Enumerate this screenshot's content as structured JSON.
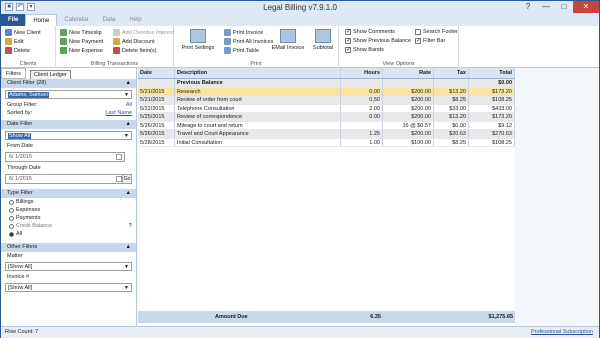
{
  "window": {
    "title": "Legal Billing v7.9.1.0"
  },
  "ribbon_tabs": [
    "File",
    "Home",
    "Calendar",
    "Data",
    "Help"
  ],
  "ribbon": {
    "clients": {
      "label": "Clients",
      "items": [
        "New Client",
        "Edit",
        "Delete"
      ]
    },
    "billing": {
      "label": "Billing Transactions",
      "items": [
        "New Timeslip",
        "New Payment",
        "New Expense",
        "Add Overdue Interest",
        "Add Discount",
        "Delete Item(s)"
      ]
    },
    "print": {
      "label": "Print",
      "print_settings": "Print Settings",
      "items": [
        "Print Invoice",
        "Print All Invoices",
        "Print Table"
      ],
      "email_invoice": "EMail Invoice",
      "subtotal": "Subtotal"
    },
    "view": {
      "label": "View Options",
      "checks": [
        {
          "label": "Show Comments",
          "checked": true
        },
        {
          "label": "Show Previous Balance",
          "checked": true
        },
        {
          "label": "Show Bands",
          "checked": true
        },
        {
          "label": "Search Footer",
          "checked": false
        },
        {
          "label": "Filter Bar",
          "checked": true
        }
      ]
    }
  },
  "left": {
    "tabs": [
      "Filters"
    ],
    "tooltip": "Client Ledger",
    "client_filter": {
      "header": "Client Filter (28)",
      "selected": "Adams, Samuel",
      "group_filter_label": "Group Filter:",
      "group_filter_value": "All",
      "sorted_by_label": "Sorted by:",
      "sorted_by_value": "Last Name"
    },
    "date_filter": {
      "header": "Date Filter",
      "selected": "Show All",
      "from_label": "From Date",
      "from_value": "6/  1/2015",
      "through_label": "Through Date",
      "through_value": "6/  1/2015",
      "go": "Go"
    },
    "type_filter": {
      "header": "Type Filter",
      "options": [
        {
          "label": "Billings",
          "on": false
        },
        {
          "label": "Expenses",
          "on": false
        },
        {
          "label": "Payments",
          "on": false
        },
        {
          "label": "Credit Balance",
          "on": false
        },
        {
          "label": "All",
          "on": true
        }
      ]
    },
    "other_filters": {
      "header": "Other Filters",
      "matter_label": "Matter",
      "matter_value": "[Show All]",
      "invoice_label": "Invoice #",
      "invoice_value": "[Show All]"
    }
  },
  "grid": {
    "columns": [
      "Date",
      "Description",
      "Hours",
      "Rate",
      "Tax",
      "Total"
    ],
    "rows": [
      {
        "date": "",
        "desc": "Previous Balance",
        "hours": "",
        "rate": "",
        "tax": "",
        "total": "$0.00",
        "style": "alt"
      },
      {
        "date": "5/21/2015",
        "desc": "Research",
        "hours": "0.00",
        "rate": "$200.00",
        "tax": "$13.20",
        "total": "$173.20",
        "style": "sel"
      },
      {
        "date": "5/21/2015",
        "desc": "Review of order from court",
        "hours": "0.50",
        "rate": "$200.00",
        "tax": "$8.25",
        "total": "$108.25",
        "style": "alt"
      },
      {
        "date": "5/22/2015",
        "desc": "Telephone Consultation",
        "hours": "2.00",
        "rate": "$200.00",
        "tax": "$33.00",
        "total": "$433.00",
        "style": ""
      },
      {
        "date": "5/25/2015",
        "desc": "Review of correspondence",
        "hours": "0.00",
        "rate": "$200.00",
        "tax": "$13.20",
        "total": "$173.20",
        "style": "alt"
      },
      {
        "date": "5/26/2015",
        "desc": "Mileage to court and return",
        "hours": "",
        "rate": "16 @ $0.57",
        "tax": "$0.00",
        "total": "$9.12",
        "style": ""
      },
      {
        "date": "5/26/2015",
        "desc": "Travel and Court Appearance",
        "hours": "1.25",
        "rate": "$200.00",
        "tax": "$20.63",
        "total": "$270.63",
        "style": "alt"
      },
      {
        "date": "5/28/2015",
        "desc": "Initial Consultation",
        "hours": "1.00",
        "rate": "$100.00",
        "tax": "$8.25",
        "total": "$108.25",
        "style": ""
      }
    ],
    "footer": {
      "label": "Amount Due",
      "hours": "6.35",
      "total": "$1,275.65"
    }
  },
  "status": {
    "row_count": "Row Count: 7",
    "link": "Professional Subscription"
  }
}
